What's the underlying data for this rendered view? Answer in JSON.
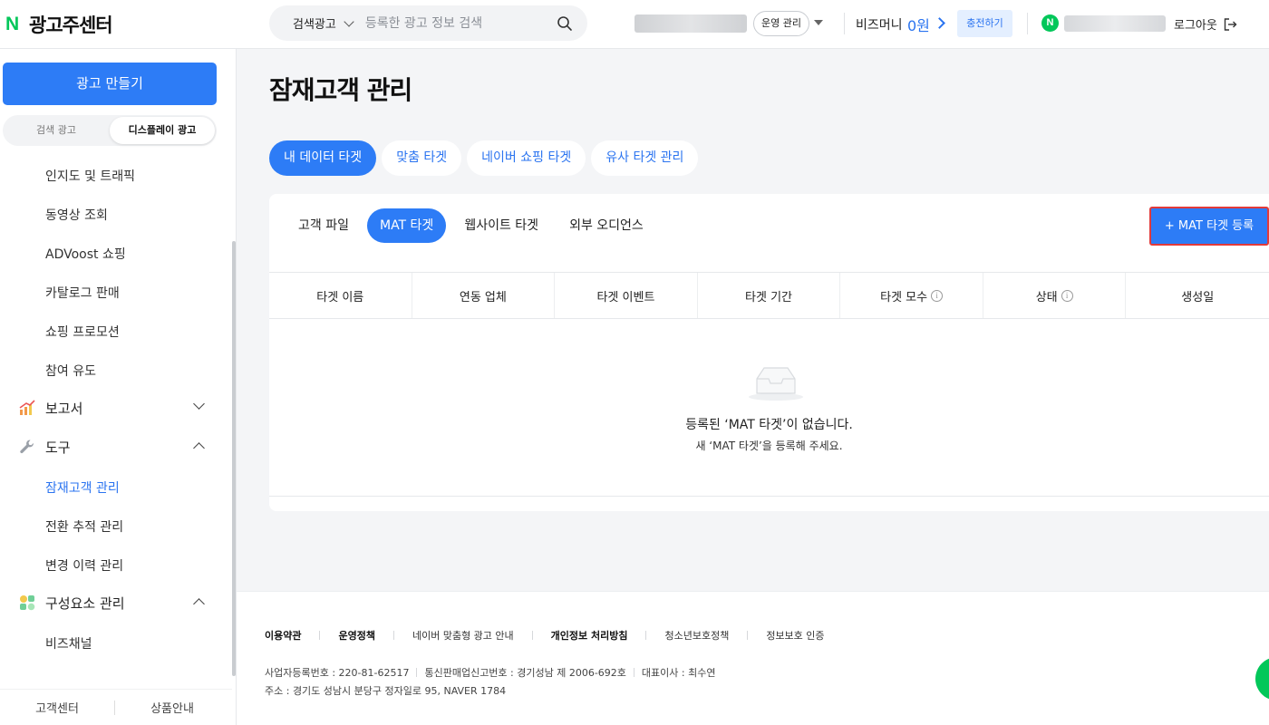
{
  "header": {
    "logo_mark": "N",
    "logo_text": "광고주센터",
    "search_type": "검색광고",
    "search_placeholder": "등록한 광고 정보 검색",
    "ops_label": "운영 관리",
    "bizmoney_label": "비즈머니",
    "bizmoney_amount": "0원",
    "charge_label": "충전하기",
    "naver_badge": "N",
    "logout_label": "로그아웃"
  },
  "sidebar": {
    "create_button": "광고 만들기",
    "toggle_left": "검색 광고",
    "toggle_right": "디스플레이 광고",
    "items": [
      {
        "label": "인지도 및 트래픽"
      },
      {
        "label": "동영상 조회"
      },
      {
        "label": "ADVoost 쇼핑"
      },
      {
        "label": "카탈로그 판매"
      },
      {
        "label": "쇼핑 프로모션"
      },
      {
        "label": "참여 유도"
      }
    ],
    "group_report": "보고서",
    "group_tools": "도구",
    "tools_items": [
      {
        "label": "잠재고객 관리"
      },
      {
        "label": "전환 추적 관리"
      },
      {
        "label": "변경 이력 관리"
      }
    ],
    "group_components": "구성요소 관리",
    "components_items": [
      {
        "label": "비즈채널"
      }
    ],
    "footer_left": "고객센터",
    "footer_right": "상품안내"
  },
  "main": {
    "title": "잠재고객 관리",
    "tabs": [
      {
        "label": "내 데이터 타겟"
      },
      {
        "label": "맞춤 타겟"
      },
      {
        "label": "네이버 쇼핑 타겟"
      },
      {
        "label": "유사 타겟 관리"
      }
    ],
    "subtabs": [
      {
        "label": "고객 파일"
      },
      {
        "label": "MAT 타겟"
      },
      {
        "label": "웹사이트 타겟"
      },
      {
        "label": "외부 오디언스"
      }
    ],
    "add_button": "+ MAT 타겟 등록",
    "columns": [
      "타겟 이름",
      "연동 업체",
      "타겟 이벤트",
      "타겟 기간",
      "타겟 모수",
      "상태",
      "생성일"
    ],
    "empty_title": "등록된 ‘MAT 타겟’이 없습니다.",
    "empty_sub": "새 ‘MAT 타겟’을 등록해 주세요."
  },
  "footer": {
    "links": [
      "이용약관",
      "운영정책",
      "네이버 맞춤형 광고 안내",
      "개인정보 처리방침",
      "청소년보호정책",
      "정보보호 인증"
    ],
    "biz_reg": "사업자등록번호 : 220-81-62517",
    "mail_order": "통신판매업신고번호 : 경기성남 제 2006-692호",
    "ceo": "대표이사 : 최수연",
    "address": "주소 : 경기도 성남시 분당구 정자일로 95, NAVER 1784"
  },
  "colors": {
    "primary": "#2d7cf6",
    "naver_green": "#03c75a",
    "highlight_border": "#e23a3a"
  }
}
